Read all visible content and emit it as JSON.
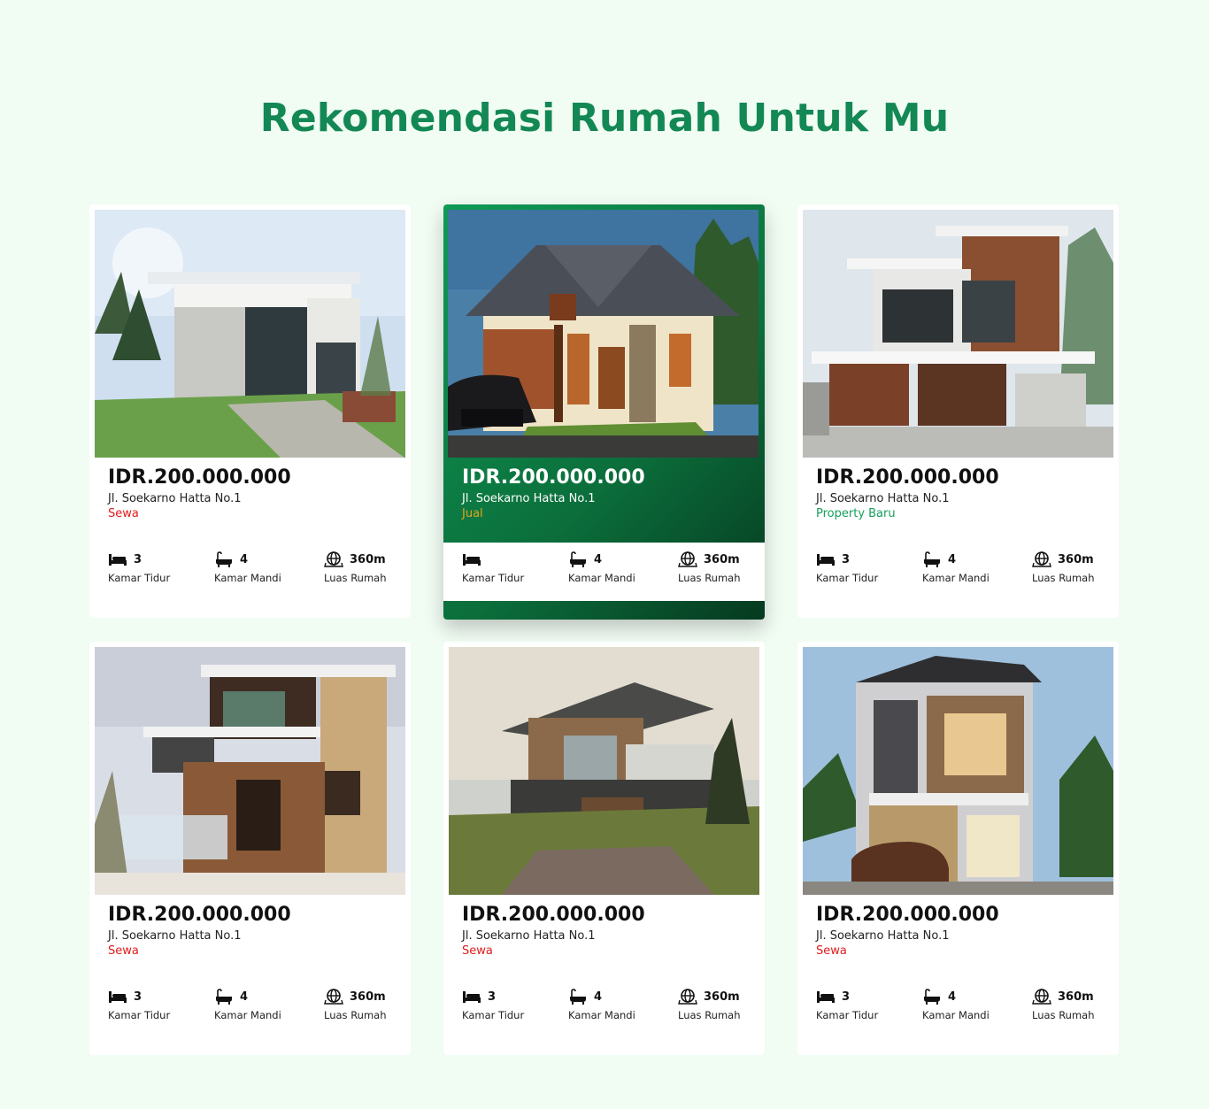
{
  "page": {
    "title": "Rekomendasi Rumah Untuk Mu"
  },
  "colors": {
    "background": "#f1fcf3",
    "title": "#138855",
    "status_sewa": "#e21b1b",
    "status_jual": "#e2a41b",
    "status_property_baru": "#15a05a",
    "active_card": "#0b7a40"
  },
  "cards": [
    {
      "price": "IDR.200.000.000",
      "address": "Jl. Soekarno Hatta No.1",
      "status": "Sewa",
      "status_color": "#e21b1b",
      "specs": {
        "bed_value": "3",
        "bed_label": "Kamar Tidur",
        "bath_value": "4",
        "bath_label": "Kamar Mandi",
        "area_value": "360m",
        "area_label": "Luas Rumah"
      }
    },
    {
      "price": "IDR.200.000.000",
      "address": "Jl. Soekarno Hatta No.1",
      "status": "Jual",
      "status_color": "#e2a41b",
      "specs": {
        "bed_value": "",
        "bed_label": "Kamar Tidur",
        "bath_value": "4",
        "bath_label": "Kamar Mandi",
        "area_value": "360m",
        "area_label": "Luas Rumah"
      }
    },
    {
      "price": "IDR.200.000.000",
      "address": "Jl. Soekarno Hatta No.1",
      "status": "Property Baru",
      "status_color": "#15a05a",
      "specs": {
        "bed_value": "3",
        "bed_label": "Kamar Tidur",
        "bath_value": "4",
        "bath_label": "Kamar Mandi",
        "area_value": "360m",
        "area_label": "Luas Rumah"
      }
    },
    {
      "price": "IDR.200.000.000",
      "address": "Jl. Soekarno Hatta No.1",
      "status": "Sewa",
      "status_color": "#e21b1b",
      "specs": {
        "bed_value": "3",
        "bed_label": "Kamar Tidur",
        "bath_value": "4",
        "bath_label": "Kamar Mandi",
        "area_value": "360m",
        "area_label": "Luas Rumah"
      }
    },
    {
      "price": "IDR.200.000.000",
      "address": "Jl. Soekarno Hatta No.1",
      "status": "Sewa",
      "status_color": "#e21b1b",
      "specs": {
        "bed_value": "3",
        "bed_label": "Kamar Tidur",
        "bath_value": "4",
        "bath_label": "Kamar Mandi",
        "area_value": "360m",
        "area_label": "Luas Rumah"
      }
    },
    {
      "price": "IDR.200.000.000",
      "address": "Jl. Soekarno Hatta No.1",
      "status": "Sewa",
      "status_color": "#e21b1b",
      "specs": {
        "bed_value": "3",
        "bed_label": "Kamar Tidur",
        "bath_value": "4",
        "bath_label": "Kamar Mandi",
        "area_value": "360m",
        "area_label": "Luas Rumah"
      }
    }
  ]
}
